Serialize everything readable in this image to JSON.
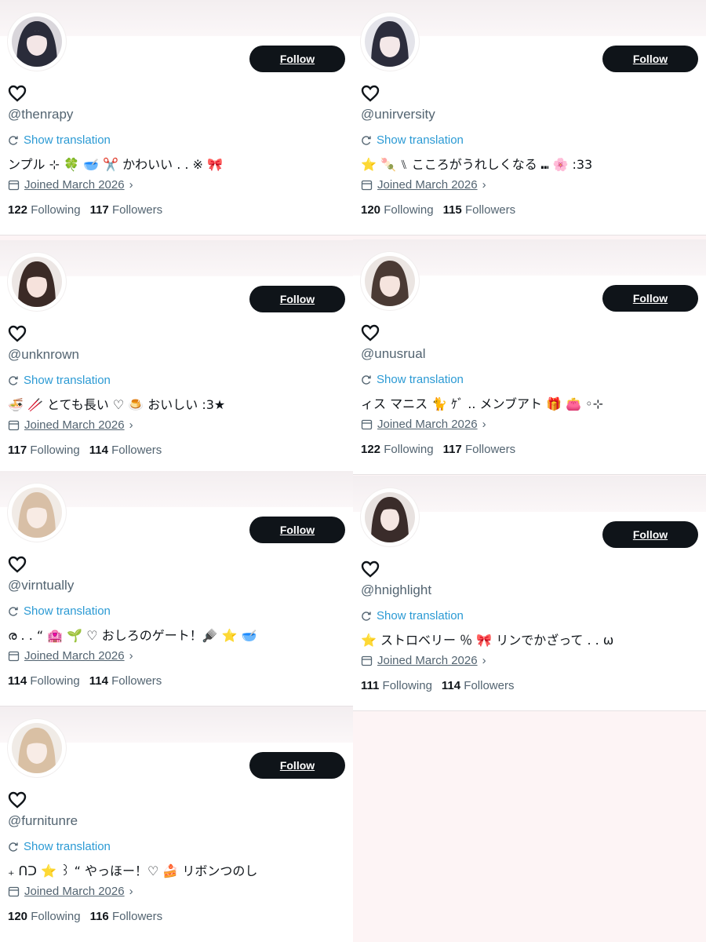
{
  "profiles": [
    {
      "handle": "@thenrapy",
      "follow_label": "Follow",
      "show_translation": "Show translation",
      "bio": "ンプル ⊹ 🍀 🥣 ✂️ かわいい . . ※ 🎀",
      "joined": "Joined March 2026",
      "following_count": "122",
      "following_label": "Following",
      "followers_count": "117",
      "followers_label": "Followers"
    },
    {
      "handle": "@unirversity",
      "follow_label": "Follow",
      "show_translation": "Show translation",
      "bio": "⭐ 🍡 ⑊ こころがうれしくなる ⑉ 🌸 :33",
      "joined": "Joined March 2026",
      "following_count": "120",
      "following_label": "Following",
      "followers_count": "115",
      "followers_label": "Followers"
    },
    {
      "handle": "@unknrown",
      "follow_label": "Follow",
      "show_translation": "Show translation",
      "bio": "🍜 🥢 とても長い ♡ 🍮 おいしい :3★",
      "joined": "Joined March 2026",
      "following_count": "117",
      "following_label": "Following",
      "followers_count": "114",
      "followers_label": "Followers"
    },
    {
      "handle": "@unusrual",
      "follow_label": "Follow",
      "show_translation": "Show translation",
      "bio": "ィス マニス 🐈 ｹﾞ .. メンブアト 🎁 👛 ◦⊹",
      "joined": "Joined March 2026",
      "following_count": "122",
      "following_label": "Following",
      "followers_count": "117",
      "followers_label": "Followers"
    },
    {
      "handle": "@virntually",
      "follow_label": "Follow",
      "show_translation": "Show translation",
      "bio": "ര . . “ 🏩 🌱 ♡ おしろのゲート！🪮 ⭐ 🥣",
      "joined": "Joined March 2026",
      "following_count": "114",
      "following_label": "Following",
      "followers_count": "114",
      "followers_label": "Followers"
    },
    {
      "handle": "@hnighlight",
      "follow_label": "Follow",
      "show_translation": "Show translation",
      "bio": "⭐ ストロベリー ％ 🎀 リンでかざって . . ω",
      "joined": "Joined March 2026",
      "following_count": "111",
      "following_label": "Following",
      "followers_count": "114",
      "followers_label": "Followers"
    },
    {
      "handle": "@furnitunre",
      "follow_label": "Follow",
      "show_translation": "Show translation",
      "bio": "₊ ᑎᑐ ⭐ ꒱ “ やっほー！♡ 🍰 リボンつのし",
      "joined": "Joined March 2026",
      "following_count": "120",
      "following_label": "Following",
      "followers_count": "116",
      "followers_label": "Followers"
    }
  ],
  "colors": {
    "button_bg": "#0f1419",
    "link": "#2b9ad4",
    "muted": "#536471",
    "empty_cell": "#fdf4f5"
  }
}
